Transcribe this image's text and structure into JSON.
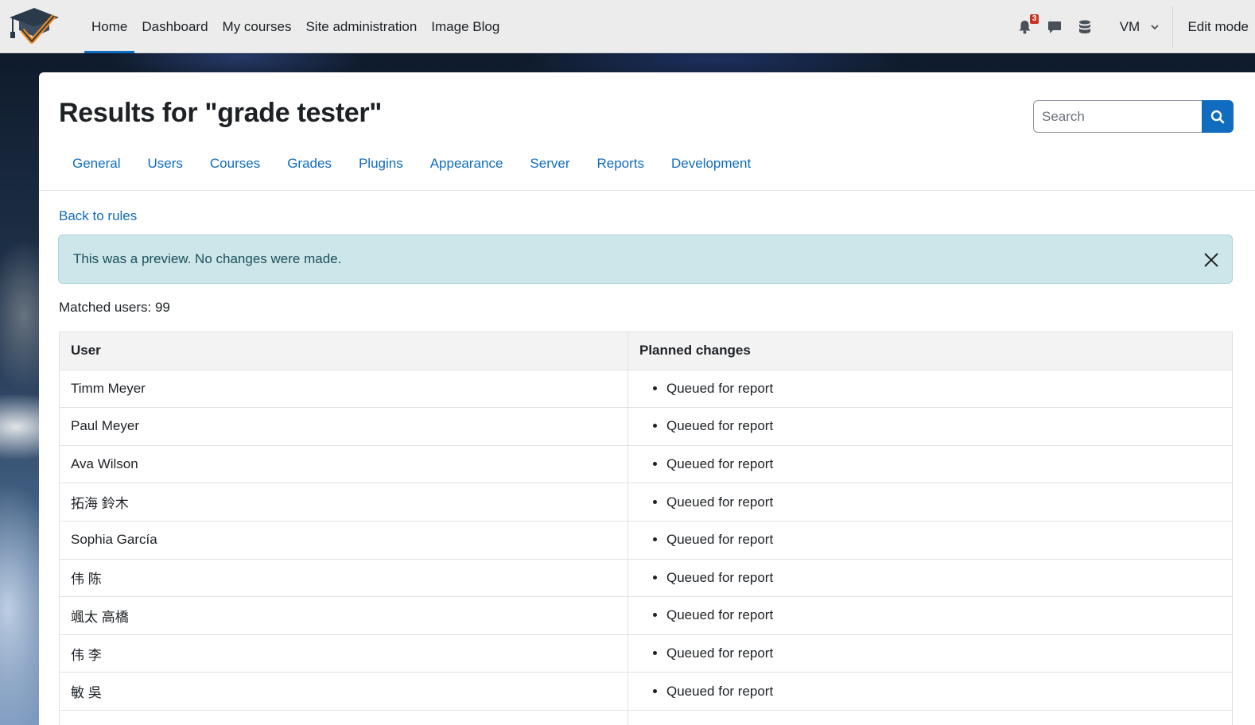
{
  "navbar": {
    "items": [
      {
        "label": "Home",
        "active": true
      },
      {
        "label": "Dashboard"
      },
      {
        "label": "My courses"
      },
      {
        "label": "Site administration"
      },
      {
        "label": "Image Blog"
      }
    ],
    "notification_count": "3",
    "user_initials": "VM",
    "edit_mode_label": "Edit mode",
    "icons": [
      "logo-mortarboard-icon",
      "bell-icon",
      "message-icon",
      "database-icon",
      "chevron-down-icon"
    ]
  },
  "page": {
    "title": "Results for \"grade tester\"",
    "search": {
      "placeholder": "Search",
      "value": ""
    },
    "tabs": [
      "General",
      "Users",
      "Courses",
      "Grades",
      "Plugins",
      "Appearance",
      "Server",
      "Reports",
      "Development"
    ],
    "back_link": "Back to rules",
    "alert": "This was a preview. No changes were made.",
    "matched_label": "Matched users: 99"
  },
  "table": {
    "headers": {
      "user": "User",
      "changes": "Planned changes"
    },
    "rows": [
      {
        "user": "Timm Meyer",
        "change": "Queued for report"
      },
      {
        "user": "Paul Meyer",
        "change": "Queued for report"
      },
      {
        "user": "Ava Wilson",
        "change": "Queued for report"
      },
      {
        "user": "拓海 鈴木",
        "change": "Queued for report"
      },
      {
        "user": "Sophia García",
        "change": "Queued for report"
      },
      {
        "user": "伟 陈",
        "change": "Queued for report"
      },
      {
        "user": "颯太 高橋",
        "change": "Queued for report"
      },
      {
        "user": "伟 李",
        "change": "Queued for report"
      },
      {
        "user": "敏 吳",
        "change": "Queued for report"
      },
      {
        "user": "",
        "change": ""
      }
    ]
  },
  "colors": {
    "accent": "#0f6cbf",
    "alert_bg": "#cce6ea",
    "navbar_bg": "#ececec",
    "badge": "#ca3120"
  }
}
